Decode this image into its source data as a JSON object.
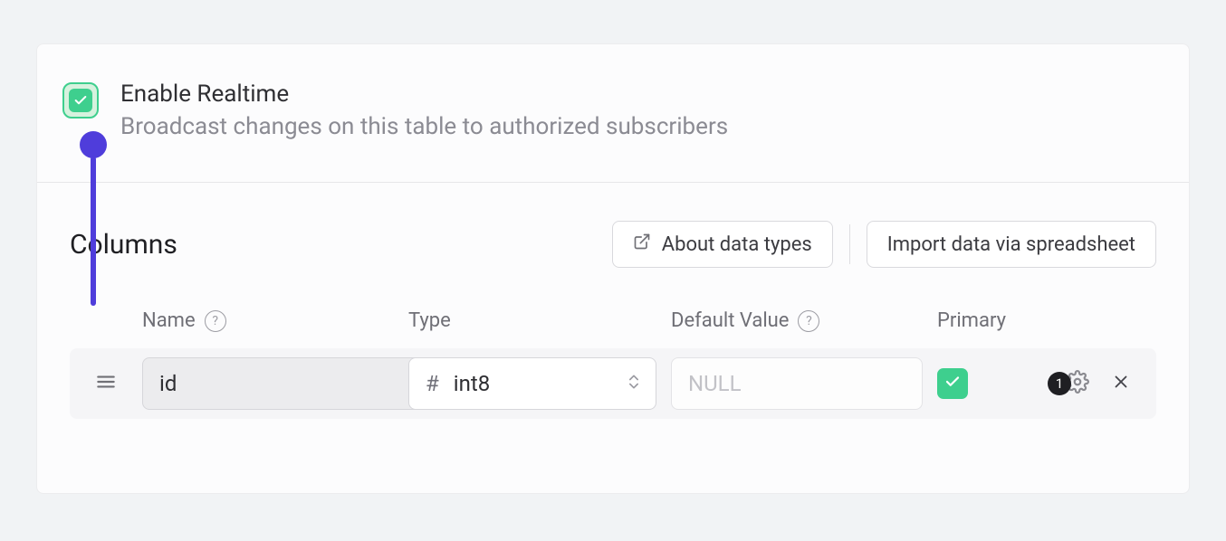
{
  "realtime": {
    "title": "Enable Realtime",
    "description": "Broadcast changes on this table to authorized subscribers",
    "checked": true
  },
  "columns": {
    "title": "Columns",
    "about_label": "About data types",
    "import_label": "Import data via spreadsheet",
    "headers": {
      "name": "Name",
      "type": "Type",
      "default": "Default Value",
      "primary": "Primary"
    },
    "rows": [
      {
        "name": "id",
        "type_symbol": "#",
        "type_label": "int8",
        "default_placeholder": "NULL",
        "default_value": "",
        "primary": true,
        "extra_settings_count": "1"
      }
    ]
  }
}
